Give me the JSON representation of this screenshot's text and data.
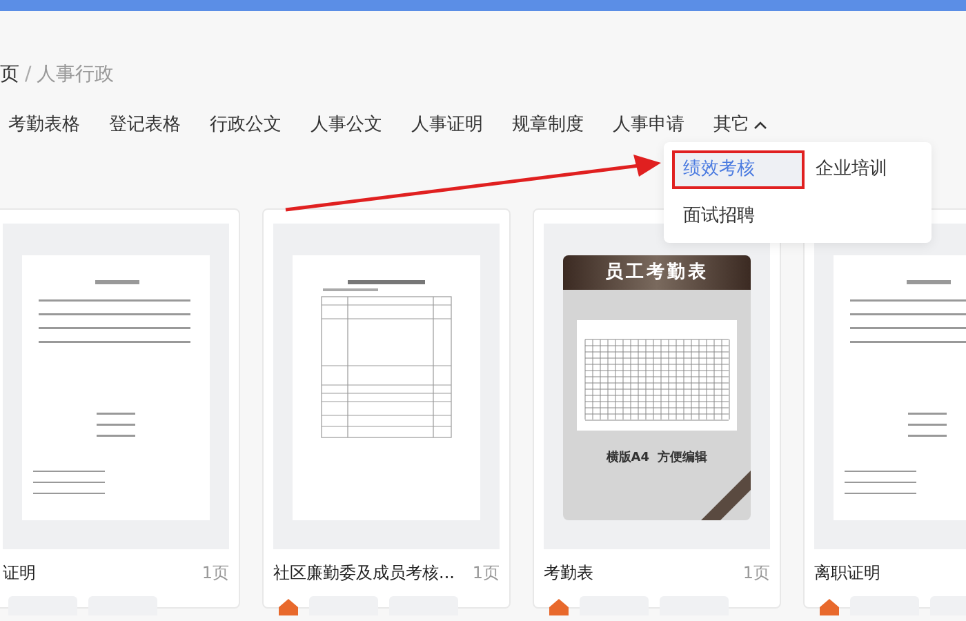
{
  "breadcrumb": [
    "页",
    "人事行政"
  ],
  "breadcrumb_separator": "/",
  "nav": [
    {
      "label": "考勤表格",
      "kind": "link"
    },
    {
      "label": "登记表格",
      "kind": "link"
    },
    {
      "label": "行政公文",
      "kind": "link"
    },
    {
      "label": "人事公文",
      "kind": "link"
    },
    {
      "label": "人事证明",
      "kind": "link"
    },
    {
      "label": "规章制度",
      "kind": "link"
    },
    {
      "label": "人事申请",
      "kind": "link"
    },
    {
      "label": "其它",
      "kind": "menu",
      "expanded": true
    }
  ],
  "dropdown": [
    {
      "label": "绩效考核",
      "selected": true,
      "highlighted": true
    },
    {
      "label": "企业培训",
      "selected": false,
      "highlighted": false
    },
    {
      "label": "面试招聘",
      "selected": false,
      "highlighted": false
    }
  ],
  "cards": [
    {
      "kind": "letter",
      "title": "证明",
      "pages": "1页",
      "hot": false
    },
    {
      "kind": "table",
      "title": "社区廉勤委及成员考核...",
      "pages": "1页",
      "hot": true
    },
    {
      "kind": "cover",
      "cover_title": "员工考勤表",
      "cover_subtitle": "横版A4  方便编辑",
      "title": "考勤表",
      "pages": "1页",
      "hot": true
    },
    {
      "kind": "letter",
      "title": "离职证明",
      "hot": true
    }
  ]
}
